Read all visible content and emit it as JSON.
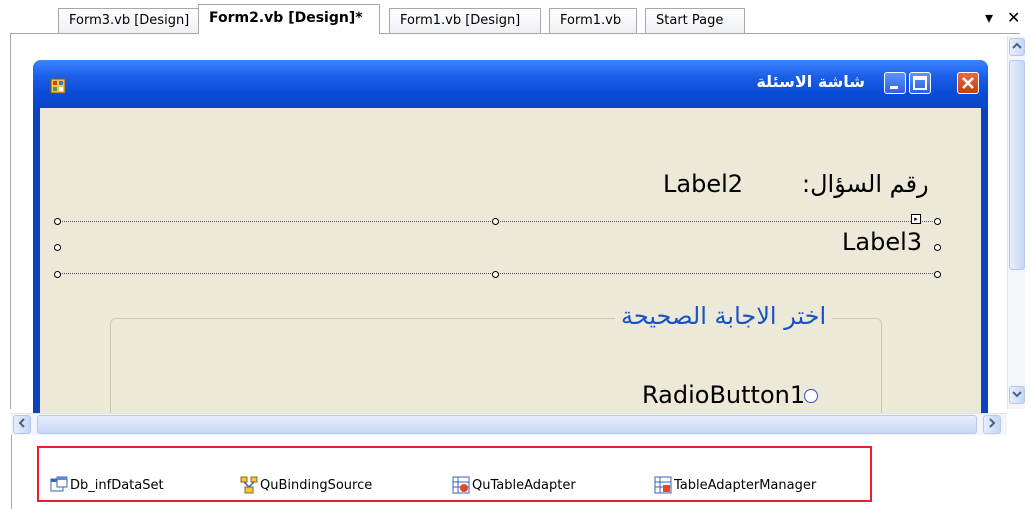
{
  "tabs": [
    {
      "label": "Form3.vb [Design]",
      "active": false
    },
    {
      "label": "Form2.vb [Design]*",
      "active": true
    },
    {
      "label": "Form1.vb [Design]",
      "active": false
    },
    {
      "label": "Form1.vb",
      "active": false
    },
    {
      "label": "Start Page",
      "active": false
    }
  ],
  "tab_controls": {
    "dropdown": "▾",
    "close": "✕"
  },
  "form": {
    "title": "شاشة الاسئلة",
    "label2": "Label2",
    "question_number_caption": "رقم السؤال:",
    "label3": "Label3",
    "group_caption": "اختر الاجابة الصحيحة",
    "radio1": "RadioButton1"
  },
  "tray": {
    "items": [
      {
        "label": "Db_infDataSet",
        "icon": "dataset-icon"
      },
      {
        "label": "QuBindingSource",
        "icon": "binding-source-icon"
      },
      {
        "label": "QuTableAdapter",
        "icon": "table-adapter-icon"
      },
      {
        "label": "TableAdapterManager",
        "icon": "table-adapter-manager-icon"
      }
    ]
  },
  "colors": {
    "titlebar": "#1b5ee7",
    "form_background": "#ece9d8",
    "group_caption": "#1752c6",
    "highlight": "#e8202e"
  }
}
